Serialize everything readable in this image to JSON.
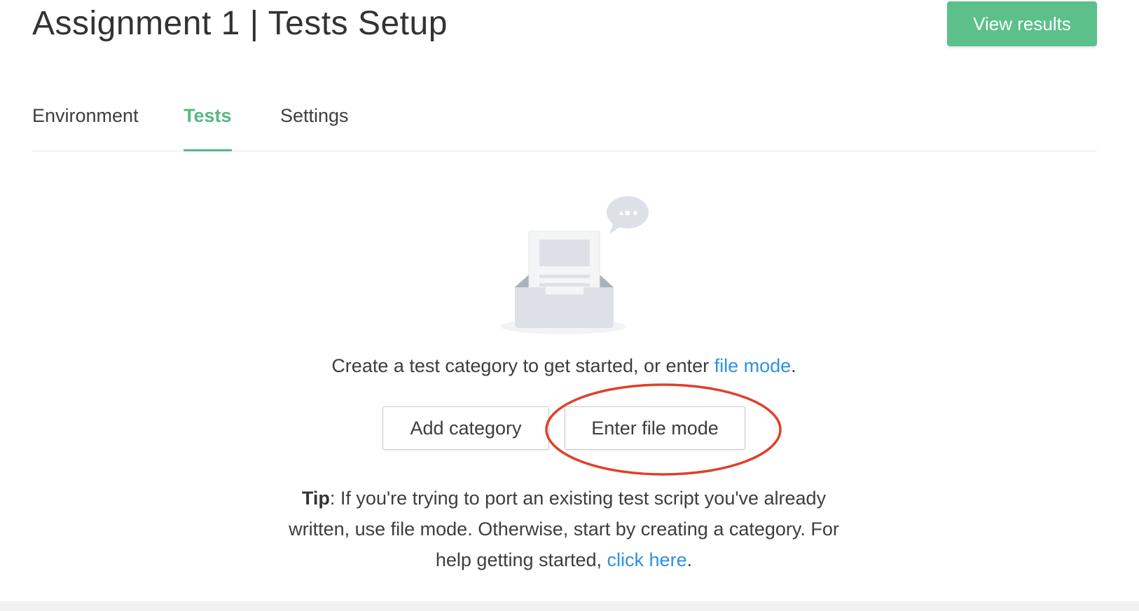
{
  "header": {
    "title": "Assignment 1 | Tests Setup",
    "view_results_label": "View results",
    "accent_color": "#5cc08a"
  },
  "tabs": [
    {
      "label": "Environment",
      "active": false
    },
    {
      "label": "Tests",
      "active": true
    },
    {
      "label": "Settings",
      "active": false
    }
  ],
  "empty_state": {
    "illustration_icon": "inbox-document-icon",
    "bubble_icon": "chat-bubble-icon",
    "intro_text": "Create a test category to get started, or enter ",
    "intro_link": "file mode",
    "intro_end": ".",
    "add_category_label": "Add category",
    "enter_file_mode_label": "Enter file mode",
    "highlight_color": "#e0402a",
    "tip_label": "Tip",
    "tip_text": ": If you're trying to port an existing test script you've already written, use file mode. Otherwise, start by creating a category. For help getting started, ",
    "tip_link": "click here",
    "tip_end": ".",
    "link_color": "#2f8fe6"
  }
}
